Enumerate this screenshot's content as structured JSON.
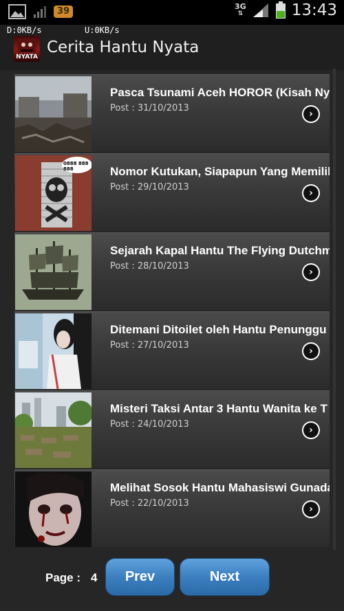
{
  "status_bar": {
    "time": "13:43",
    "notification_count": "39",
    "network_type": "3G",
    "download_rate": "D:0KB/s",
    "upload_rate": "U:0KB/s"
  },
  "app": {
    "title": "Cerita Hantu Nyata",
    "icon_label": "NYATA"
  },
  "items": [
    {
      "title": "Pasca Tsunami Aceh HOROR (Kisah Nyata)",
      "date": "Post : 31/10/2013",
      "thumb": "tsunami-ruins"
    },
    {
      "title": "Nomor Kutukan, Siapapun Yang Memiliki",
      "date": "Post : 29/10/2013",
      "thumb": "skull-door",
      "thumb_caption": "0888 888 888"
    },
    {
      "title": "Sejarah Kapal Hantu The Flying Dutchman",
      "date": "Post : 28/10/2013",
      "thumb": "ghost-ship"
    },
    {
      "title": "Ditemani Ditoilet oleh Hantu Penunggu",
      "date": "Post : 27/10/2013",
      "thumb": "toilet-ghost"
    },
    {
      "title": "Misteri Taksi Antar 3 Hantu Wanita ke T",
      "date": "Post : 24/10/2013",
      "thumb": "cemetery"
    },
    {
      "title": "Melihat Sosok Hantu Mahasiswi Gunadarma",
      "date": "Post : 22/10/2013",
      "thumb": "ghost-face"
    }
  ],
  "pager": {
    "label": "Page :",
    "current": "4",
    "prev_label": "Prev",
    "next_label": "Next"
  },
  "colors": {
    "accent_button": "#3b7fc0",
    "background": "#262626",
    "battery": "#4caf1d"
  }
}
